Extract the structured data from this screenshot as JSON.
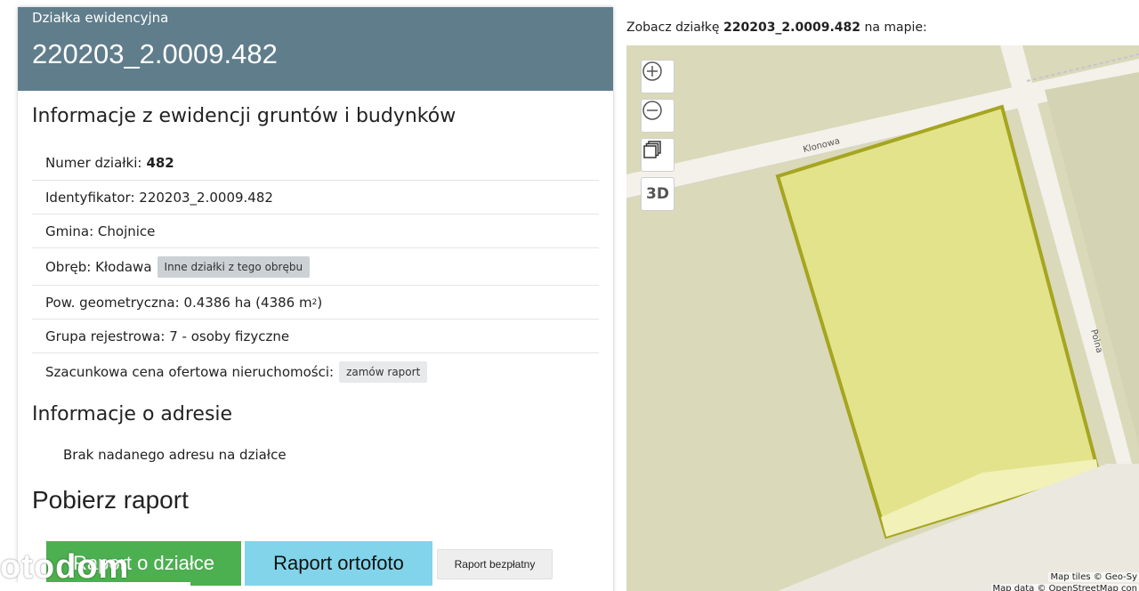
{
  "header": {
    "kicker": "Działka ewidencyjna",
    "title": "220203_2.0009.482"
  },
  "egib": {
    "title": "Informacje z ewidencji gruntów i budynków",
    "rows": [
      {
        "label": "Numer działki: ",
        "value": "482"
      },
      {
        "label": "Identyfikator: 220203_2.0009.482"
      },
      {
        "label": "Gmina: Chojnice"
      },
      {
        "label": "Obręb: Kłodawa",
        "button": "Inne działki z tego obrębu"
      },
      {
        "label": "Pow. geometryczna: 0.4386 ha (4386 m",
        "sup": "2",
        "suffix": ")"
      },
      {
        "label": "Grupa rejestrowa: 7 - osoby fizyczne"
      },
      {
        "label": "Szacunkowa cena ofertowa nieruchomości: ",
        "button": "zamów raport"
      }
    ]
  },
  "address": {
    "title": "Informacje o adresie",
    "text": "Brak nadanego adresu na działce"
  },
  "report": {
    "title": "Pobierz raport",
    "btn_plot": "Raport o działce",
    "btn_ortho": "Raport ortofoto",
    "btn_free": "Raport bezpłatny"
  },
  "watermark": "otodom",
  "map": {
    "caption_pre": "Zobacz działkę ",
    "caption_id": "220203_2.0009.482",
    "caption_post": " na mapie:",
    "road_klonowa": "Klonowa",
    "road_polna": "Polna",
    "ctrl_3d": "3D",
    "attr_tiles": "Map tiles © Geo-Sy",
    "attr_data": "Map data © OpenStreetMap con",
    "colors": {
      "parcel_fill": "#e3e38c",
      "parcel_stroke": "#a5a520",
      "land": "#dad9b9",
      "road": "#f3f1ea"
    }
  }
}
